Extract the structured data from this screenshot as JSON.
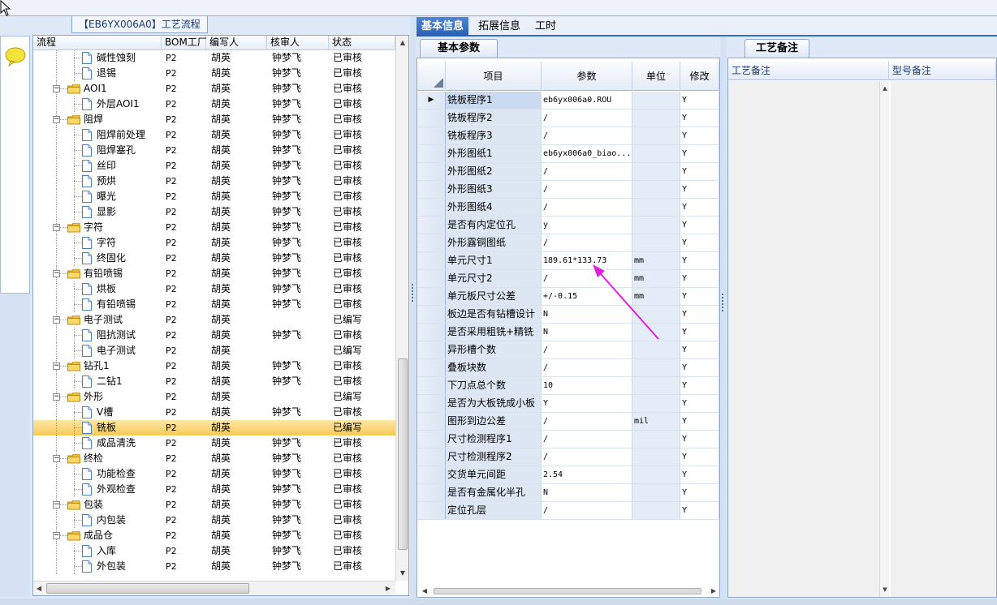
{
  "tree": {
    "title": "【EB6YX006A0】工艺流程",
    "columns": [
      "流程",
      "BOM工厂",
      "编写人",
      "核审人",
      "状态"
    ],
    "rows": [
      {
        "level": 2,
        "type": "doc",
        "name": "碱性蚀刻",
        "bom": "P2",
        "author": "胡英",
        "reviewer": "钟梦飞",
        "status": "已审核"
      },
      {
        "level": 2,
        "type": "doc",
        "name": "退锡",
        "bom": "P2",
        "author": "胡英",
        "reviewer": "钟梦飞",
        "status": "已审核"
      },
      {
        "level": 1,
        "type": "folder",
        "name": "AOI1",
        "bom": "P2",
        "author": "胡英",
        "reviewer": "钟梦飞",
        "status": "已审核"
      },
      {
        "level": 2,
        "type": "doc",
        "name": "外层AOI1",
        "bom": "P2",
        "author": "胡英",
        "reviewer": "钟梦飞",
        "status": "已审核"
      },
      {
        "level": 1,
        "type": "folder",
        "name": "阻焊",
        "bom": "P2",
        "author": "胡英",
        "reviewer": "钟梦飞",
        "status": "已审核"
      },
      {
        "level": 2,
        "type": "doc",
        "name": "阻焊前处理",
        "bom": "P2",
        "author": "胡英",
        "reviewer": "钟梦飞",
        "status": "已审核"
      },
      {
        "level": 2,
        "type": "doc",
        "name": "阻焊塞孔",
        "bom": "P2",
        "author": "胡英",
        "reviewer": "钟梦飞",
        "status": "已审核"
      },
      {
        "level": 2,
        "type": "doc",
        "name": "丝印",
        "bom": "P2",
        "author": "胡英",
        "reviewer": "钟梦飞",
        "status": "已审核"
      },
      {
        "level": 2,
        "type": "doc",
        "name": "预烘",
        "bom": "P2",
        "author": "胡英",
        "reviewer": "钟梦飞",
        "status": "已审核"
      },
      {
        "level": 2,
        "type": "doc",
        "name": "曝光",
        "bom": "P2",
        "author": "胡英",
        "reviewer": "钟梦飞",
        "status": "已审核"
      },
      {
        "level": 2,
        "type": "doc",
        "name": "显影",
        "bom": "P2",
        "author": "胡英",
        "reviewer": "钟梦飞",
        "status": "已审核"
      },
      {
        "level": 1,
        "type": "folder",
        "name": "字符",
        "bom": "P2",
        "author": "胡英",
        "reviewer": "钟梦飞",
        "status": "已审核"
      },
      {
        "level": 2,
        "type": "doc",
        "name": "字符",
        "bom": "P2",
        "author": "胡英",
        "reviewer": "钟梦飞",
        "status": "已审核"
      },
      {
        "level": 2,
        "type": "doc",
        "name": "终固化",
        "bom": "P2",
        "author": "胡英",
        "reviewer": "钟梦飞",
        "status": "已审核"
      },
      {
        "level": 1,
        "type": "folder",
        "name": "有铅喷锡",
        "bom": "P2",
        "author": "胡英",
        "reviewer": "钟梦飞",
        "status": "已审核"
      },
      {
        "level": 2,
        "type": "doc",
        "name": "烘板",
        "bom": "P2",
        "author": "胡英",
        "reviewer": "钟梦飞",
        "status": "已审核"
      },
      {
        "level": 2,
        "type": "doc",
        "name": "有铅喷锡",
        "bom": "P2",
        "author": "胡英",
        "reviewer": "钟梦飞",
        "status": "已审核"
      },
      {
        "level": 1,
        "type": "folder",
        "name": "电子测试",
        "bom": "P2",
        "author": "胡英",
        "reviewer": "",
        "status": "已编写"
      },
      {
        "level": 2,
        "type": "doc",
        "name": "阻抗测试",
        "bom": "P2",
        "author": "胡英",
        "reviewer": "钟梦飞",
        "status": "已审核"
      },
      {
        "level": 2,
        "type": "doc",
        "name": "电子测试",
        "bom": "P2",
        "author": "胡英",
        "reviewer": "",
        "status": "已编写"
      },
      {
        "level": 1,
        "type": "folder",
        "name": "钻孔1",
        "bom": "P2",
        "author": "胡英",
        "reviewer": "钟梦飞",
        "status": "已审核"
      },
      {
        "level": 2,
        "type": "doc",
        "name": "二钻1",
        "bom": "P2",
        "author": "胡英",
        "reviewer": "钟梦飞",
        "status": "已审核"
      },
      {
        "level": 1,
        "type": "folder",
        "name": "外形",
        "bom": "P2",
        "author": "胡英",
        "reviewer": "",
        "status": "已编写"
      },
      {
        "level": 2,
        "type": "doc",
        "name": "V槽",
        "bom": "P2",
        "author": "胡英",
        "reviewer": "钟梦飞",
        "status": "已审核"
      },
      {
        "level": 2,
        "type": "doc",
        "name": "铣板",
        "bom": "P2",
        "author": "胡英",
        "reviewer": "",
        "status": "已编写",
        "selected": true
      },
      {
        "level": 2,
        "type": "doc",
        "name": "成品清洗",
        "bom": "P2",
        "author": "胡英",
        "reviewer": "钟梦飞",
        "status": "已审核"
      },
      {
        "level": 1,
        "type": "folder",
        "name": "终检",
        "bom": "P2",
        "author": "胡英",
        "reviewer": "钟梦飞",
        "status": "已审核"
      },
      {
        "level": 2,
        "type": "doc",
        "name": "功能检查",
        "bom": "P2",
        "author": "胡英",
        "reviewer": "钟梦飞",
        "status": "已审核"
      },
      {
        "level": 2,
        "type": "doc",
        "name": "外观检查",
        "bom": "P2",
        "author": "胡英",
        "reviewer": "钟梦飞",
        "status": "已审核"
      },
      {
        "level": 1,
        "type": "folder",
        "name": "包装",
        "bom": "P2",
        "author": "胡英",
        "reviewer": "钟梦飞",
        "status": "已审核"
      },
      {
        "level": 2,
        "type": "doc",
        "name": "内包装",
        "bom": "P2",
        "author": "胡英",
        "reviewer": "钟梦飞",
        "status": "已审核"
      },
      {
        "level": 1,
        "type": "folder",
        "name": "成品仓",
        "bom": "P2",
        "author": "胡英",
        "reviewer": "钟梦飞",
        "status": "已审核"
      },
      {
        "level": 2,
        "type": "doc",
        "name": "入库",
        "bom": "P2",
        "author": "胡英",
        "reviewer": "钟梦飞",
        "status": "已审核"
      },
      {
        "level": 2,
        "type": "doc",
        "name": "外包装",
        "bom": "P2",
        "author": "胡英",
        "reviewer": "钟梦飞",
        "status": "已审核"
      }
    ]
  },
  "main_tabs": [
    {
      "label": "基本信息",
      "active": true
    },
    {
      "label": "拓展信息",
      "active": false
    },
    {
      "label": "工时",
      "active": false
    }
  ],
  "params": {
    "tab_label": "基本参数",
    "columns": [
      "项目",
      "参数",
      "单位",
      "修改"
    ],
    "rows": [
      {
        "item": "铣板程序1",
        "value": "eb6yx006a0.ROU",
        "unit": "",
        "mod": "Y",
        "current": true
      },
      {
        "item": "铣板程序2",
        "value": "/",
        "unit": "",
        "mod": "Y"
      },
      {
        "item": "铣板程序3",
        "value": "/",
        "unit": "",
        "mod": "Y"
      },
      {
        "item": "外形图纸1",
        "value": "eb6yx006a0_biao...",
        "unit": "",
        "mod": "Y"
      },
      {
        "item": "外形图纸2",
        "value": "/",
        "unit": "",
        "mod": "Y"
      },
      {
        "item": "外形图纸3",
        "value": "/",
        "unit": "",
        "mod": "Y"
      },
      {
        "item": "外形图纸4",
        "value": "/",
        "unit": "",
        "mod": "Y"
      },
      {
        "item": "是否有内定位孔",
        "value": "y",
        "unit": "",
        "mod": "Y"
      },
      {
        "item": "外形露铜图纸",
        "value": "/",
        "unit": "",
        "mod": "Y"
      },
      {
        "item": "单元尺寸1",
        "value": "189.61*133.73",
        "unit": "mm",
        "mod": "Y"
      },
      {
        "item": "单元尺寸2",
        "value": "/",
        "unit": "mm",
        "mod": "Y"
      },
      {
        "item": "单元板尺寸公差",
        "value": "+/-0.15",
        "unit": "mm",
        "mod": "Y"
      },
      {
        "item": "板边是否有钻槽设计",
        "value": "N",
        "unit": "",
        "mod": "Y"
      },
      {
        "item": "是否采用粗铣+精铣",
        "value": "N",
        "unit": "",
        "mod": "Y"
      },
      {
        "item": "异形槽个数",
        "value": "/",
        "unit": "",
        "mod": "Y"
      },
      {
        "item": "叠板块数",
        "value": "/",
        "unit": "",
        "mod": "Y"
      },
      {
        "item": "下刀点总个数",
        "value": "10",
        "unit": "",
        "mod": "Y"
      },
      {
        "item": "是否为大板铣成小板",
        "value": "Y",
        "unit": "",
        "mod": "Y"
      },
      {
        "item": "图形到边公差",
        "value": "/",
        "unit": "mil",
        "mod": "Y"
      },
      {
        "item": "尺寸检测程序1",
        "value": "/",
        "unit": "",
        "mod": "Y"
      },
      {
        "item": "尺寸检测程序2",
        "value": "/",
        "unit": "",
        "mod": "Y"
      },
      {
        "item": "交货单元间距",
        "value": "2.54",
        "unit": "",
        "mod": "Y"
      },
      {
        "item": "是否有金属化半孔",
        "value": "N",
        "unit": "",
        "mod": "Y"
      },
      {
        "item": "定位孔层",
        "value": "/",
        "unit": "",
        "mod": "Y"
      }
    ]
  },
  "notes": {
    "tab_label": "工艺备注",
    "columns": [
      "工艺备注",
      "型号备注"
    ]
  },
  "colors": {
    "accent": "#285fae",
    "selection": "#f7c958",
    "annotation_arrow": "#e020e0"
  },
  "icons": {
    "chat": "chat-bubble-icon",
    "folder": "folder-icon",
    "document": "document-icon",
    "row_pointer": "row-pointer-icon"
  }
}
